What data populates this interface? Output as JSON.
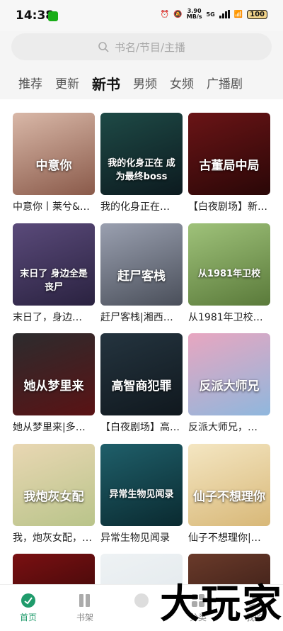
{
  "status": {
    "time": "14:38",
    "speed": "3.90\nMB/s",
    "battery": "100",
    "net": "5G"
  },
  "search": {
    "placeholder": "书名/节目/主播"
  },
  "tabs": [
    "推荐",
    "更新",
    "新书",
    "男频",
    "女频",
    "广播剧"
  ],
  "active_tab": 2,
  "books": [
    {
      "title": "中意你丨莱兮&…",
      "cover_text": "中意你",
      "colors": [
        "#d9b8a8",
        "#8a5a4a"
      ]
    },
    {
      "title": "我的化身正在…",
      "cover_text": "我的化身正在 成为最终boss",
      "colors": [
        "#1e4a46",
        "#0c1a1f"
      ]
    },
    {
      "title": "【白夜剧场】新…",
      "cover_text": "古董局中局",
      "colors": [
        "#6a1416",
        "#2a0707"
      ]
    },
    {
      "title": "末日了，身边…",
      "cover_text": "末日了 身边全是丧尸",
      "colors": [
        "#5a4a7a",
        "#2a2240"
      ]
    },
    {
      "title": "赶尸客栈|湘西…",
      "cover_text": "赶尸客栈",
      "colors": [
        "#9aa0b0",
        "#4a4f5a"
      ]
    },
    {
      "title": "从1981年卫校…",
      "cover_text": "从1981年卫校",
      "colors": [
        "#9fc27a",
        "#5a7a3a"
      ]
    },
    {
      "title": "她从梦里来|多…",
      "cover_text": "她从梦里来",
      "colors": [
        "#2c2c2e",
        "#5a1214"
      ]
    },
    {
      "title": "【白夜剧场】高…",
      "cover_text": "高智商犯罪",
      "colors": [
        "#24343f",
        "#10181e"
      ]
    },
    {
      "title": "反派大师兄，…",
      "cover_text": "反派大师兄",
      "colors": [
        "#e8a6c0",
        "#8fb7dd"
      ]
    },
    {
      "title": "我，炮灰女配，…",
      "cover_text": "我炮灰女配",
      "colors": [
        "#e9d7b3",
        "#b9c48a"
      ]
    },
    {
      "title": "异常生物见闻录",
      "cover_text": "异常生物见闻录",
      "colors": [
        "#1f5f6a",
        "#0a2a30"
      ]
    },
    {
      "title": "仙子不想理你|…",
      "cover_text": "仙子不想理你",
      "colors": [
        "#f4e6c2",
        "#d8b878"
      ]
    },
    {
      "title": "",
      "cover_text": "",
      "colors": [
        "#7a1012",
        "#2a0606"
      ]
    },
    {
      "title": "",
      "cover_text": "",
      "colors": [
        "#eef2f4",
        "#dfe6ea"
      ]
    },
    {
      "title": "",
      "cover_text": "",
      "colors": [
        "#6a3a2a",
        "#2a1410"
      ]
    }
  ],
  "bottom_nav": [
    {
      "label": "首页",
      "icon": "home-icon",
      "active": true
    },
    {
      "label": "书架",
      "icon": "bookshelf-icon",
      "active": false
    },
    {
      "label": "",
      "icon": "center-icon",
      "active": false
    },
    {
      "label": "分类",
      "icon": "category-icon",
      "active": false
    },
    {
      "label": "我的",
      "icon": "profile-icon",
      "active": false
    }
  ],
  "watermark": "大玩家",
  "accent": "#1f9b6b"
}
